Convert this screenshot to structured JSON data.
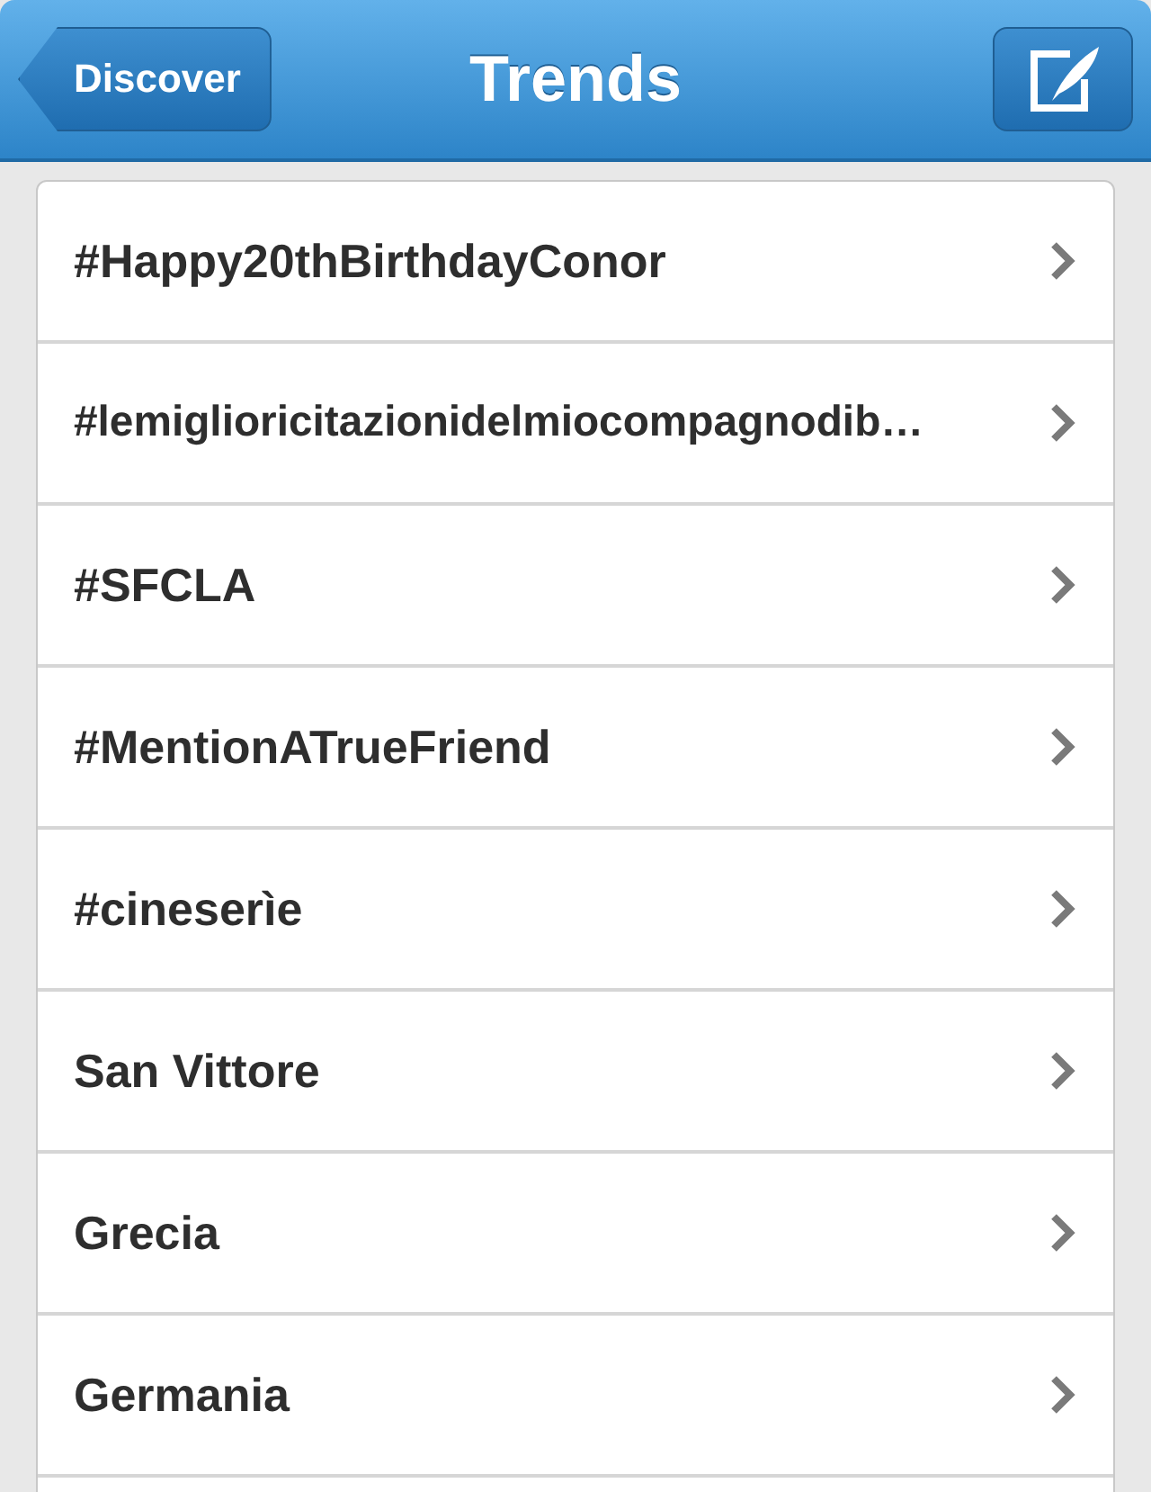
{
  "nav_bar": {
    "back_button": "Discover",
    "title": "Trends"
  },
  "trends": [
    {
      "label": "#Happy20thBirthdayConor"
    },
    {
      "label": "#lemiglioricitazionidelmiocompagnodib…"
    },
    {
      "label": "#SFCLA"
    },
    {
      "label": "#MentionATrueFriend"
    },
    {
      "label": "#cineserìe"
    },
    {
      "label": "San Vittore"
    },
    {
      "label": "Grecia"
    },
    {
      "label": "Germania"
    }
  ]
}
